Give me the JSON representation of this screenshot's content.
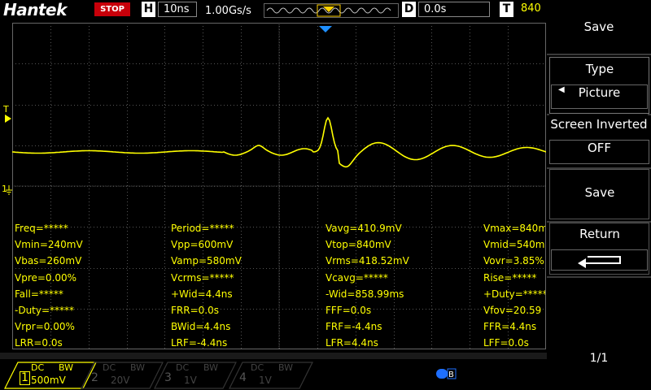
{
  "header": {
    "brand": "Hantek",
    "run_state": "STOP",
    "h_label": "H",
    "timebase": "10ns",
    "sample_rate": "1.00Gs/s",
    "d_label": "D",
    "delay": "0.0s",
    "t_label": "T",
    "trigger_level": "840"
  },
  "markers": {
    "trigger_marker": "T",
    "ch1_marker": "1"
  },
  "measurements": [
    "Freq=*****",
    "Period=*****",
    "Vavg=410.9mV",
    "Vmax=840m",
    "Vmin=240mV",
    "Vpp=600mV",
    "Vtop=840mV",
    "Vmid=540m",
    "Vbas=260mV",
    "Vamp=580mV",
    "Vrms=418.52mV",
    "Vovr=3.85%",
    "Vpre=0.00%",
    "Vcrms=*****",
    "Vcavg=*****",
    "Rise=*****",
    "Fall=*****",
    "+Wid=4.4ns",
    "-Wid=858.99ms",
    "+Duty=*****",
    "-Duty=*****",
    "FRR=0.0s",
    "FFF=0.0s",
    "Vfov=20.59",
    "Vrpr=0.00%",
    "BWid=4.4ns",
    "FRF=-4.4ns",
    "FFR=4.4ns",
    "LRR=0.0s",
    "LRF=-4.4ns",
    "LFR=4.4ns",
    "LFF=0.0s"
  ],
  "menu": {
    "title": "Save",
    "type_label": "Type",
    "type_value": "Picture",
    "inverted_label": "Screen Inverted",
    "inverted_value": "OFF",
    "save_label": "Save",
    "return_label": "Return",
    "page": "1/1"
  },
  "channels": [
    {
      "num": "1",
      "coupling": "DC",
      "bw": "BW",
      "scale": "500mV",
      "active": true
    },
    {
      "num": "2",
      "coupling": "DC",
      "bw": "BW",
      "scale": "20V",
      "active": false
    },
    {
      "num": "3",
      "coupling": "DC",
      "bw": "BW",
      "scale": "1V",
      "active": false
    },
    {
      "num": "4",
      "coupling": "DC",
      "bw": "BW",
      "scale": "1V",
      "active": false
    }
  ],
  "status_icon": "bluetooth-icon",
  "colors": {
    "trace": "#ffff00",
    "stop": "#c8000a",
    "trigger_marker": "#1e90ff",
    "grid": "#555555"
  }
}
